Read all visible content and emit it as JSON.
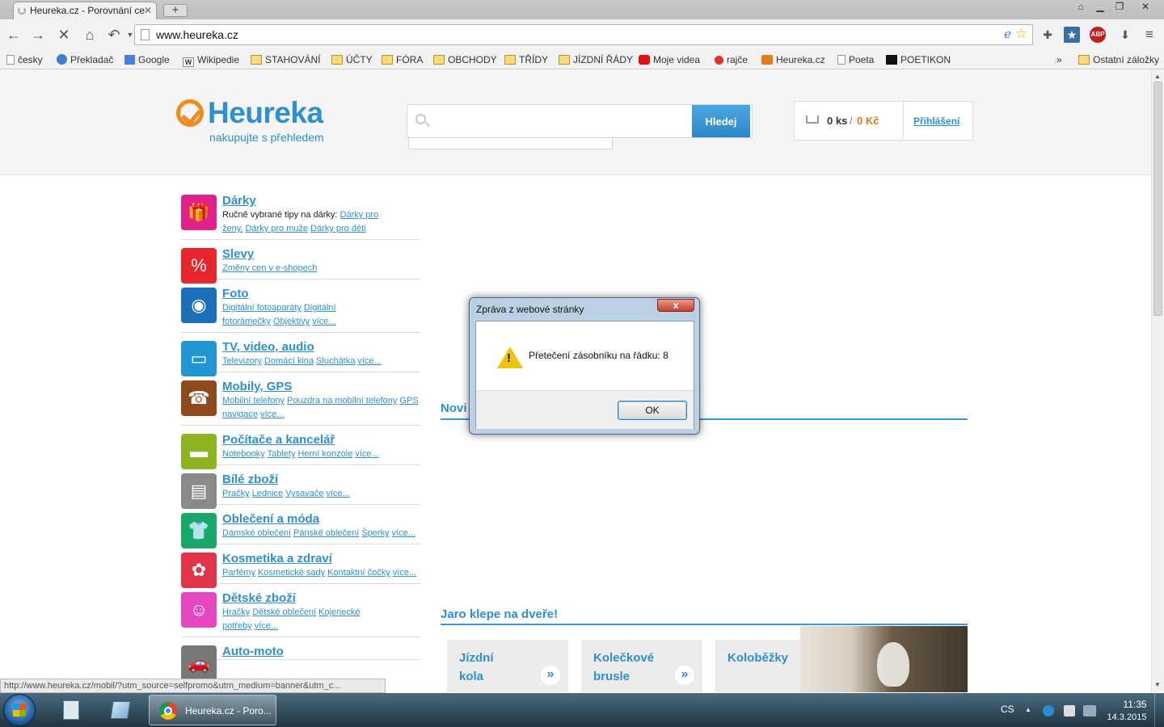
{
  "browser": {
    "tab_title": "Heureka.cz - Porovnání ce",
    "tab_close": "✕",
    "new_tab": "+",
    "url": "www.heureka.cz",
    "icons": [
      "back-icon",
      "forward-icon",
      "stop-icon",
      "home-icon",
      "undo-icon",
      "ie-tab-icon",
      "star-icon",
      "puzzle-icon",
      "bookmark-icon",
      "adblock-icon",
      "download-icon",
      "menu-icon"
    ],
    "abp": "ABP"
  },
  "bookmarks": {
    "items": [
      {
        "label": "česky",
        "icon": "page"
      },
      {
        "label": "Překladač",
        "icon": "globe"
      },
      {
        "label": "Google",
        "icon": "g"
      },
      {
        "label": "Wikipedie",
        "icon": "w"
      },
      {
        "label": "STAHOVÁNÍ",
        "icon": "folder"
      },
      {
        "label": "ÚČTY",
        "icon": "folder"
      },
      {
        "label": "FÓRA",
        "icon": "folder"
      },
      {
        "label": "OBCHODY",
        "icon": "folder"
      },
      {
        "label": "TŘÍDY",
        "icon": "folder"
      },
      {
        "label": "JÍZDNÍ ŘÁDY",
        "icon": "folder"
      },
      {
        "label": "Moje videa",
        "icon": "yt"
      },
      {
        "label": "rajče",
        "icon": "rajce"
      },
      {
        "label": "Heureka.cz",
        "icon": "heur"
      },
      {
        "label": "Poeta",
        "icon": "page"
      },
      {
        "label": "POETIKON",
        "icon": "poet"
      }
    ],
    "overflow": "»",
    "other": "Ostatní záložky"
  },
  "header": {
    "logo": "Heureka",
    "tagline": "nakupujte s přehledem",
    "search_button": "Hledej",
    "search_placeholder": "",
    "cart_qty": "0 ks",
    "cart_sep": "/",
    "cart_price": "0 Kč",
    "login": "Přihlášení"
  },
  "categories": [
    {
      "title": "Dárky",
      "color": "#e2228c",
      "prefix": "Ručně vybrané tipy na dárky: ",
      "links": [
        "Dárky pro ženy,",
        "Dárky pro muže",
        "Dárky pro děti"
      ]
    },
    {
      "title": "Slevy",
      "color": "#e8262d",
      "prefix": "",
      "links": [
        "Změny cen v e-shopech"
      ]
    },
    {
      "title": "Foto",
      "color": "#1c6fb9",
      "prefix": "",
      "links": [
        "Digitální fotoaparáty",
        "Digitální fotorámečky",
        "Objektivy",
        "více..."
      ]
    },
    {
      "title": "TV, video, audio",
      "color": "#2196d3",
      "prefix": "",
      "links": [
        "Televizory",
        "Domácí kina",
        "Sluchátka",
        "více..."
      ]
    },
    {
      "title": "Mobily, GPS",
      "color": "#8e4a1c",
      "prefix": "",
      "links": [
        "Mobilní telefony",
        "Pouzdra na mobilní telefony",
        "GPS navigace",
        "více..."
      ]
    },
    {
      "title": "Počítače a kancelář",
      "color": "#8fb421",
      "prefix": "",
      "links": [
        "Notebooky",
        "Tablety",
        "Herní konzole",
        "více..."
      ]
    },
    {
      "title": "Bílé zboží",
      "color": "#8a8a8a",
      "prefix": "",
      "links": [
        "Pračky",
        "Lednice",
        "Vysavače",
        "více..."
      ]
    },
    {
      "title": "Oblečení a móda",
      "color": "#1aa86a",
      "prefix": "",
      "links": [
        "Dámské oblečení",
        "Pánské oblečení",
        "Šperky",
        "více..."
      ]
    },
    {
      "title": "Kosmetika a zdraví",
      "color": "#e0344a",
      "prefix": "",
      "links": [
        "Parfémy",
        "Kosmetické sady",
        "Kontaktní čočky",
        "více..."
      ]
    },
    {
      "title": "Dětské zboží",
      "color": "#e548c0",
      "prefix": "",
      "links": [
        "Hračky",
        "Dětské oblečení",
        "Kojenecké potřeby",
        "více..."
      ]
    },
    {
      "title": "Auto-moto",
      "color": "#777777",
      "prefix": "",
      "links": []
    }
  ],
  "sections": {
    "news_title": "Novi",
    "spring_title": "Jaro klepe na dveře!",
    "promos": [
      {
        "line1": "Jízdní",
        "line2": "kola"
      },
      {
        "line1": "Kolečkové",
        "line2": "brusle"
      },
      {
        "line1": "Koloběžky",
        "line2": ""
      }
    ],
    "promo_arrow": "»"
  },
  "status_url": "http://www.heureka.cz/mobil/?utm_source=selfpromo&utm_medium=banner&utm_c...",
  "dialog": {
    "title": "Zpráva z webové stránky",
    "close": "x",
    "message": "Přetečení zásobníku na řádku: 8",
    "ok": "OK",
    "warn_glyph": "!"
  },
  "taskbar": {
    "chrome_label": "Heureka.cz - Poro...",
    "lang": "CS",
    "tray_arrow": "▲",
    "time": "11:35",
    "date": "14.3.2015"
  }
}
